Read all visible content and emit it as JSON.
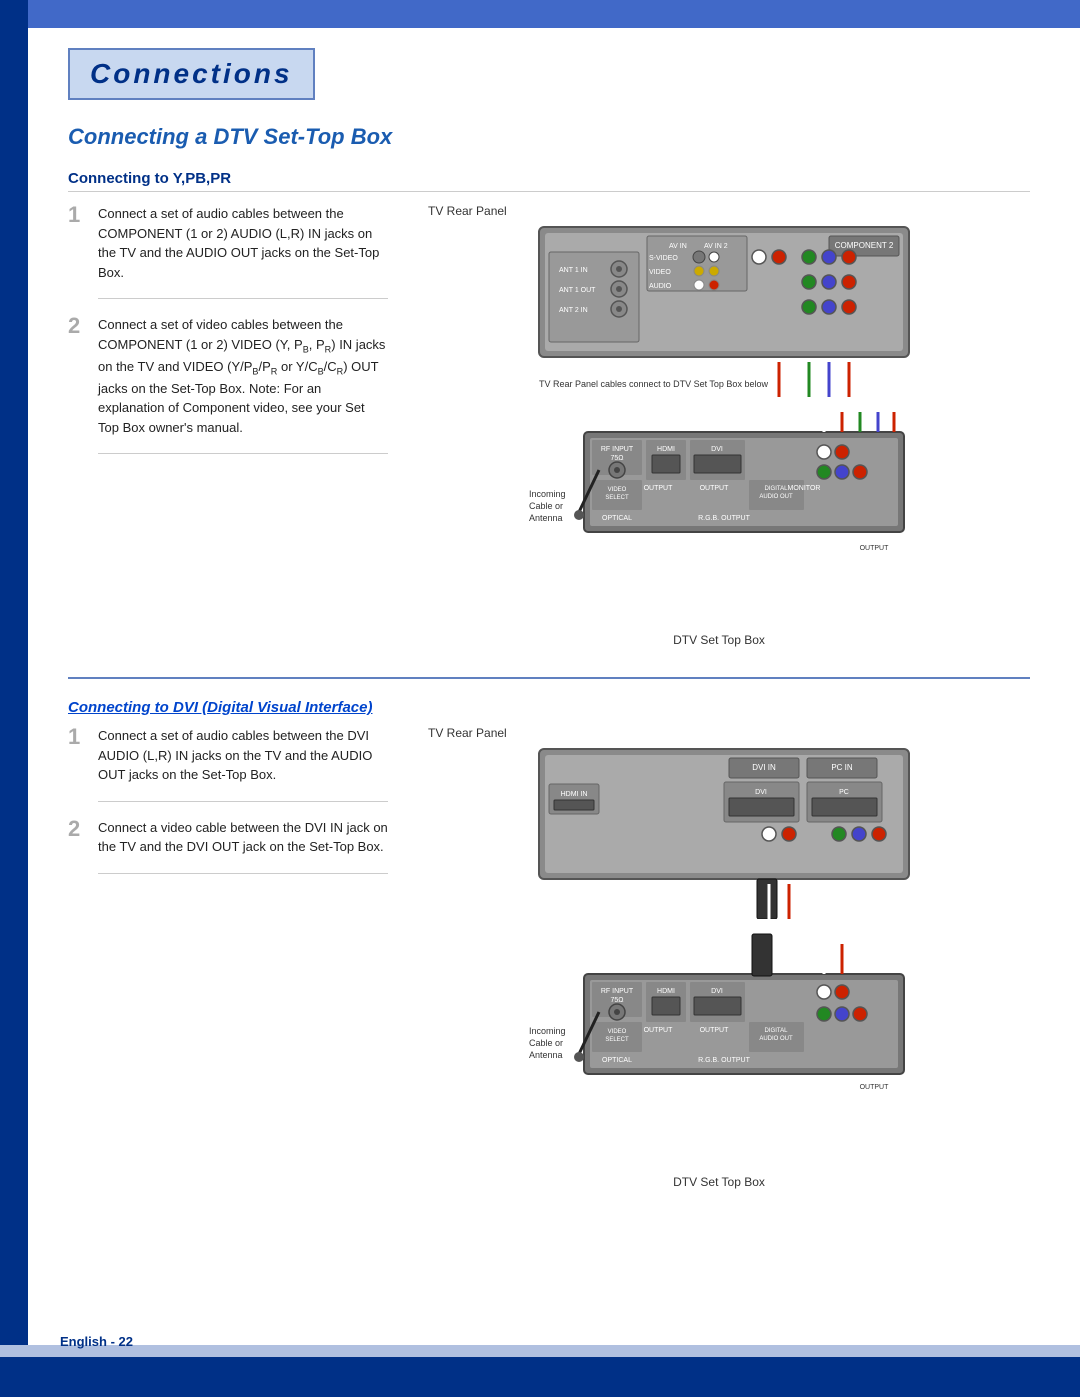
{
  "page": {
    "title": "Connections",
    "section_title": "Connecting a DTV Set-Top Box",
    "subsection1": {
      "heading": "Connecting to Y,PB,PR",
      "step1": {
        "number": "1",
        "text": "Connect a set of audio cables between the COMPONENT (1 or 2) AUDIO (L,R) IN jacks on the TV and the AUDIO OUT jacks on the Set-Top Box."
      },
      "step2": {
        "number": "2",
        "text": "Connect a set of video cables between the COMPONENT (1 or 2) VIDEO (Y, PB, PR) IN jacks on the TV and VIDEO (Y/PB/PR or Y/CB/CR) OUT jacks on the Set-Top Box. Note: For an explanation of Component video, see your Set Top Box owner's manual."
      },
      "diagram1_label": "TV Rear Panel",
      "diagram1_caption": "DTV Set Top Box",
      "incoming_label1": "Incoming\nCable or\nAntenna"
    },
    "subsection2": {
      "heading": "Connecting to DVI (Digital Visual Interface)",
      "step1": {
        "number": "1",
        "text": "Connect a set of audio cables between the DVI AUDIO (L,R) IN jacks on the TV and the AUDIO OUT jacks on the Set-Top Box."
      },
      "step2": {
        "number": "2",
        "text": "Connect a video cable between the DVI IN jack on the TV and the DVI OUT jack on the Set-Top Box."
      },
      "diagram2_label": "TV Rear Panel",
      "diagram2_caption": "DTV Set Top Box",
      "incoming_label2": "Incoming\nCable or\nAntenna"
    }
  },
  "footer": {
    "language": "English",
    "page_number": "22",
    "full_label": "English - 22"
  },
  "colors": {
    "dark_blue": "#003087",
    "medium_blue": "#1a5cb0",
    "light_blue": "#4169c8",
    "title_bg": "#c8d8f0",
    "accent": "#6080c0"
  }
}
